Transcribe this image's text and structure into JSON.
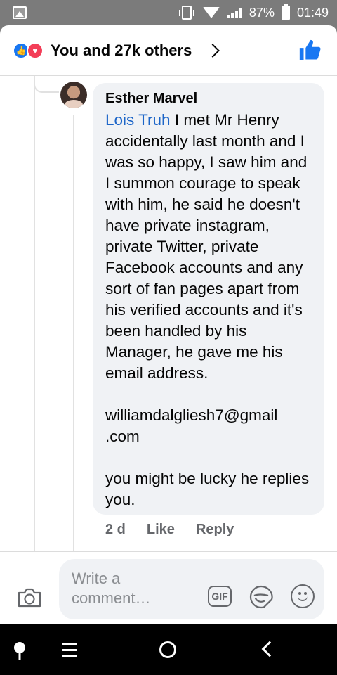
{
  "status_bar": {
    "battery": "87%",
    "time": "01:49"
  },
  "reactions": {
    "summary": "You and 27k others",
    "icons": [
      "like-icon",
      "heart-icon"
    ],
    "like_color": "#1877f2",
    "heart_color": "#f33e58"
  },
  "comment": {
    "author": "Esther Marvel",
    "mention": "Lois Truh",
    "text": " I met Mr Henry accidentally last month and I was so happy, I saw him and I summon courage to speak with him, he said he doesn't have private instagram, private Twitter, private Facebook accounts and any sort of fan pages apart from his verified accounts and it's been handled by his Manager, he gave me his email address.\n\nwilliamdalgliesh7@gmail\n.com\n\nyou might be lucky he replies you.",
    "time": "2 d",
    "like_label": "Like",
    "reply_label": "Reply"
  },
  "composer": {
    "placeholder": "Write a comment…",
    "gif_label": "GIF"
  },
  "colors": {
    "link": "#1c65c8",
    "bubble_bg": "#f0f2f5",
    "meta_text": "#65676b"
  }
}
